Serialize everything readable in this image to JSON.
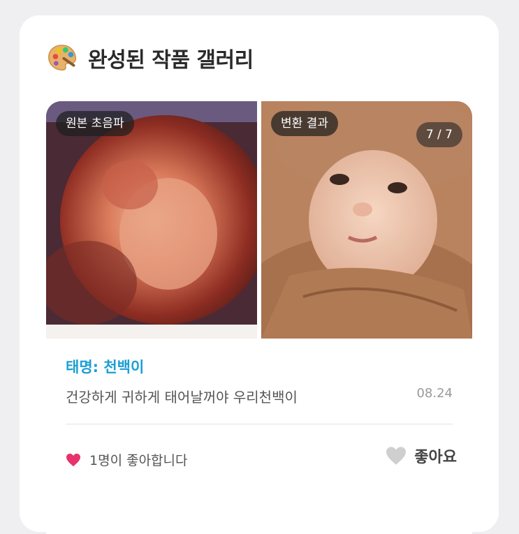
{
  "gallery": {
    "title": "완성된 작품 갤러리",
    "icon": "palette-icon"
  },
  "post": {
    "original_label": "원본 초음파",
    "result_label": "변환 결과",
    "counter": "7 / 7",
    "name": "태명: 천백이",
    "message": "건강하게 귀하게 태어날꺼야 우리천백이",
    "date": "08.24",
    "likes_text": "1명이 좋아합니다",
    "like_button": "좋아요"
  },
  "colors": {
    "accent_name": "#1a9fd4",
    "heart_active": "#e7326d",
    "heart_inactive": "#cfcfcf"
  }
}
